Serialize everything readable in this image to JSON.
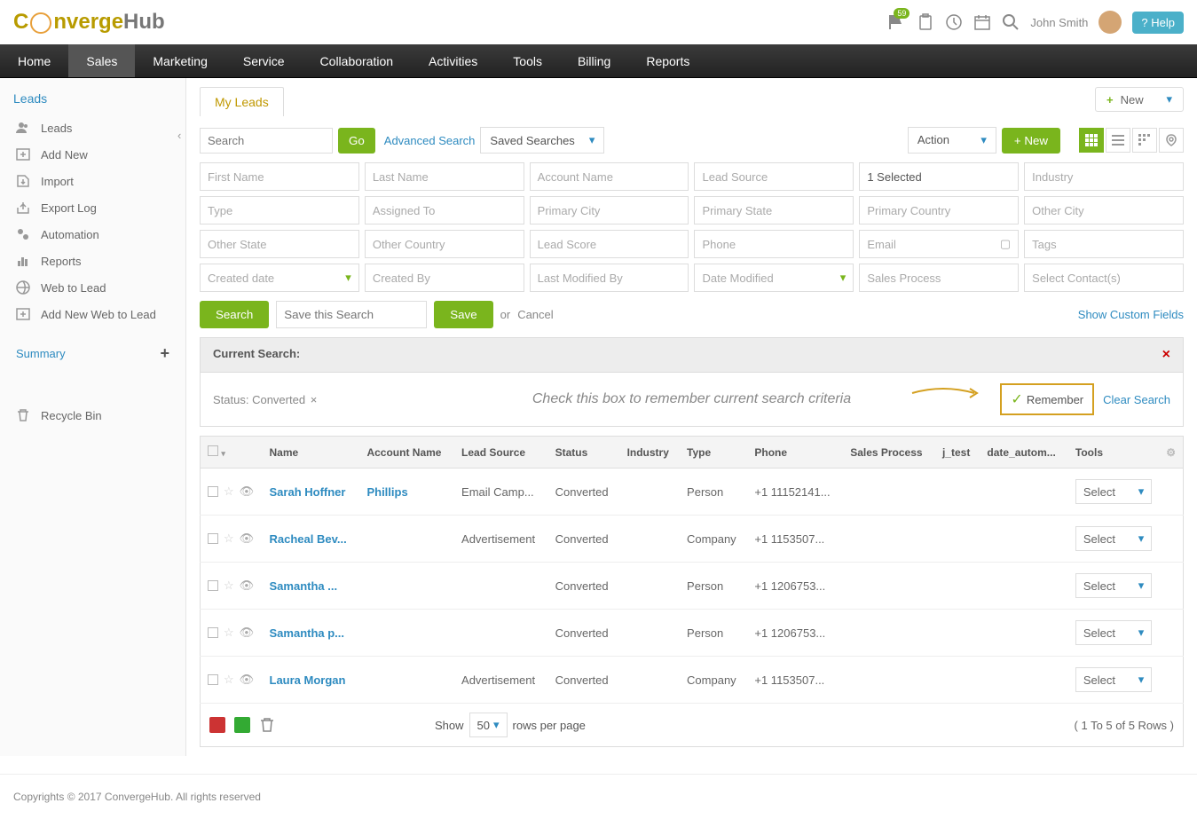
{
  "header": {
    "logo_part1": "C",
    "logo_part2": "nverge",
    "logo_part3": "Hub",
    "notification_count": "59",
    "user_name": "John Smith",
    "help_label": "? Help"
  },
  "main_nav": [
    "Home",
    "Sales",
    "Marketing",
    "Service",
    "Collaboration",
    "Activities",
    "Tools",
    "Billing",
    "Reports"
  ],
  "sidebar": {
    "title": "Leads",
    "items": [
      {
        "icon": "users",
        "label": "Leads"
      },
      {
        "icon": "plus",
        "label": "Add New"
      },
      {
        "icon": "import",
        "label": "Import"
      },
      {
        "icon": "export",
        "label": "Export Log"
      },
      {
        "icon": "gear",
        "label": "Automation"
      },
      {
        "icon": "chart",
        "label": "Reports"
      },
      {
        "icon": "web",
        "label": "Web to Lead"
      },
      {
        "icon": "plus",
        "label": "Add New Web to Lead"
      }
    ],
    "summary": "Summary",
    "recycle": "Recycle Bin"
  },
  "tab": {
    "label": "My Leads"
  },
  "new_dropdown": "New",
  "search": {
    "placeholder": "Search",
    "go": "Go",
    "advanced": "Advanced Search",
    "saved": "Saved Searches",
    "action": "Action",
    "new_btn": "+ New"
  },
  "filters": {
    "first_name": "First Name",
    "last_name": "Last Name",
    "account_name": "Account Name",
    "lead_source": "Lead Source",
    "selected": "1 Selected",
    "industry": "Industry",
    "type": "Type",
    "assigned_to": "Assigned To",
    "primary_city": "Primary City",
    "primary_state": "Primary State",
    "primary_country": "Primary Country",
    "other_city": "Other City",
    "other_state": "Other State",
    "other_country": "Other Country",
    "lead_score": "Lead Score",
    "phone": "Phone",
    "email": "Email",
    "tags": "Tags",
    "created_date": "Created date",
    "created_by": "Created By",
    "last_modified_by": "Last Modified By",
    "date_modified": "Date Modified",
    "sales_process": "Sales Process",
    "select_contacts": "Select Contact(s)"
  },
  "actions": {
    "search": "Search",
    "save_placeholder": "Save this Search",
    "save": "Save",
    "or": "or",
    "cancel": "Cancel",
    "show_custom": "Show Custom Fields"
  },
  "current_search": {
    "label": "Current Search:",
    "status": "Status: Converted",
    "callout": "Check this box to remember current search criteria",
    "remember": "Remember",
    "clear": "Clear Search"
  },
  "table": {
    "headers": [
      "Name",
      "Account Name",
      "Lead Source",
      "Status",
      "Industry",
      "Type",
      "Phone",
      "Sales Process",
      "j_test",
      "date_autom...",
      "Tools"
    ],
    "rows": [
      {
        "name": "Sarah Hoffner",
        "account": "Phillips",
        "source": "Email Camp...",
        "status": "Converted",
        "industry": "",
        "type": "Person",
        "phone": "+1 11152141...",
        "select": "Select"
      },
      {
        "name": "Racheal Bev...",
        "account": "",
        "source": "Advertisement",
        "status": "Converted",
        "industry": "",
        "type": "Company",
        "phone": "+1 1153507...",
        "select": "Select"
      },
      {
        "name": "Samantha ...",
        "account": "",
        "source": "",
        "status": "Converted",
        "industry": "",
        "type": "Person",
        "phone": "+1 1206753...",
        "select": "Select"
      },
      {
        "name": "Samantha p...",
        "account": "",
        "source": "",
        "status": "Converted",
        "industry": "",
        "type": "Person",
        "phone": "+1 1206753...",
        "select": "Select"
      },
      {
        "name": "Laura Morgan",
        "account": "",
        "source": "Advertisement",
        "status": "Converted",
        "industry": "",
        "type": "Company",
        "phone": "+1 1153507...",
        "select": "Select"
      }
    ],
    "show": "Show",
    "per_page": "50",
    "rpp": "rows per page",
    "count": "( 1 To 5 of 5 Rows )"
  },
  "footer": "Copyrights © 2017 ConvergeHub. All rights reserved"
}
